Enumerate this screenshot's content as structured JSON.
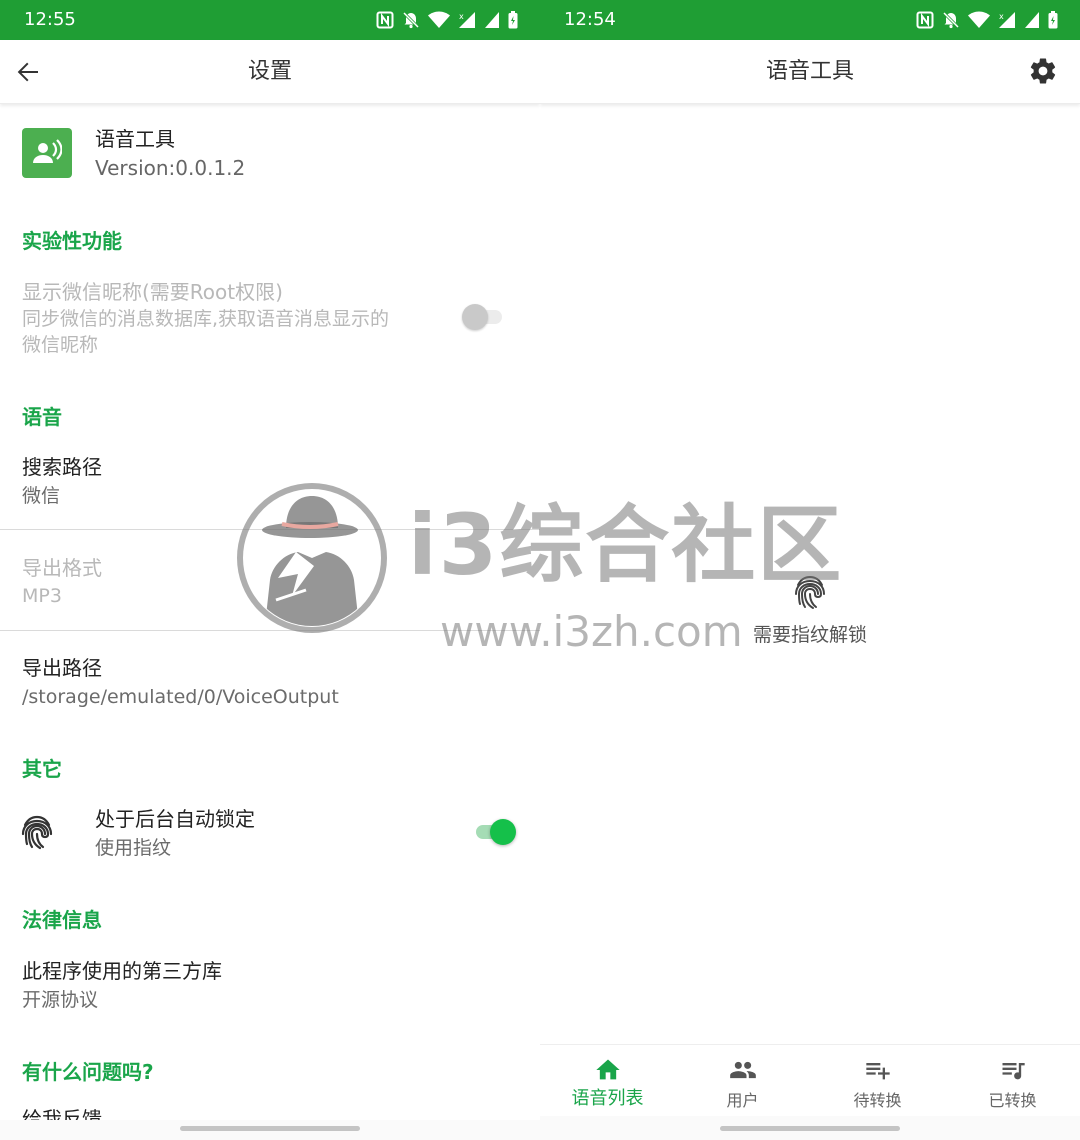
{
  "left_screen": {
    "status_bar": {
      "time": "12:55"
    },
    "app_bar": {
      "title": "设置"
    },
    "app_info": {
      "name": "语音工具",
      "version": "Version:0.0.1.2"
    },
    "sections": {
      "experimental": {
        "title": "实验性功能",
        "wechat_nickname": {
          "title": "显示微信昵称(需要Root权限)",
          "summary_line1": "同步微信的消息数据库,获取语音消息显示的",
          "summary_line2": "微信昵称",
          "enabled": false
        }
      },
      "voice": {
        "title": "语音",
        "search_path": {
          "title": "搜索路径",
          "value": "微信"
        },
        "export_format": {
          "title": "导出格式",
          "value": "MP3"
        },
        "export_path": {
          "title": "导出路径",
          "value": "/storage/emulated/0/VoiceOutput"
        }
      },
      "other": {
        "title": "其它",
        "auto_lock": {
          "title": "处于后台自动锁定",
          "summary": "使用指纹",
          "enabled": true
        }
      },
      "legal": {
        "title": "法律信息",
        "licenses": {
          "title": "此程序使用的第三方库",
          "summary": "开源协议"
        }
      },
      "questions": {
        "title": "有什么问题吗?",
        "feedback": "给我反馈"
      }
    }
  },
  "right_screen": {
    "status_bar": {
      "time": "12:54"
    },
    "app_bar": {
      "title": "语音工具"
    },
    "lock_message": "需要指纹解锁",
    "bottom_nav": [
      {
        "label": "语音列表",
        "icon": "home-icon",
        "active": true
      },
      {
        "label": "用户",
        "icon": "people-icon",
        "active": false
      },
      {
        "label": "待转换",
        "icon": "playlist-add-icon",
        "active": false
      },
      {
        "label": "已转换",
        "icon": "queue-music-icon",
        "active": false
      }
    ]
  },
  "watermark": {
    "name": "i3综合社区",
    "url": "www.i3zh.com"
  },
  "colors": {
    "status_bar": "#1f9e34",
    "accent": "#1aa54a",
    "app_icon": "#4caf50",
    "toggle_on": "#15c04a"
  }
}
